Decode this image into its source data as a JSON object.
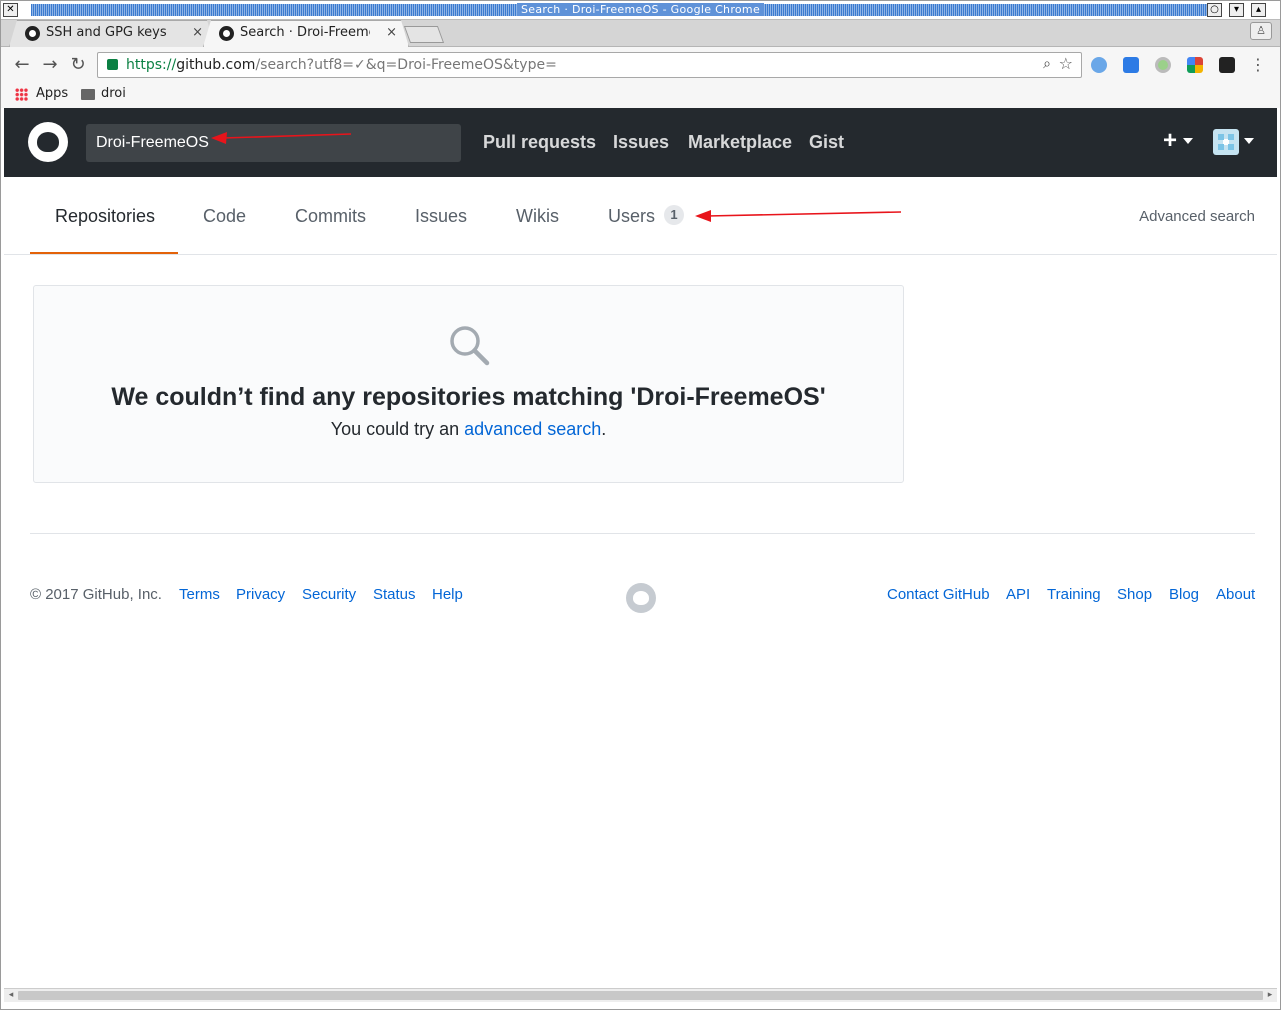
{
  "window": {
    "title": "Search · Droi-FreemeOS - Google Chrome"
  },
  "tabs": [
    {
      "label": "SSH and GPG keys",
      "close": "×"
    },
    {
      "label": "Search · Droi-Freeme",
      "close": "×"
    }
  ],
  "toolbar": {
    "url_scheme": "https://",
    "url_host": "github.com",
    "url_rest": "/search?utf8=✓&q=Droi-FreemeOS&type="
  },
  "bookmarks": {
    "apps": "Apps",
    "folder": "droi"
  },
  "header": {
    "search_value": "Droi-FreemeOS",
    "nav": [
      "Pull requests",
      "Issues",
      "Marketplace",
      "Gist"
    ],
    "plus": "+"
  },
  "subnav": {
    "items": [
      "Repositories",
      "Code",
      "Commits",
      "Issues",
      "Wikis",
      "Users"
    ],
    "users_count": "1",
    "advanced_search": "Advanced search"
  },
  "blankslate": {
    "heading": "We couldn’t find any repositories matching 'Droi-FreemeOS'",
    "text_before": "You could try an ",
    "link": "advanced search",
    "text_after": "."
  },
  "footer": {
    "copyright": "© 2017 GitHub, Inc.",
    "left_links": [
      "Terms",
      "Privacy",
      "Security",
      "Status",
      "Help"
    ],
    "right_links": [
      "Contact GitHub",
      "API",
      "Training",
      "Shop",
      "Blog",
      "About"
    ]
  },
  "colors": {
    "header_bg": "#24292e",
    "link": "#0366d6",
    "selected_underline": "#e36209",
    "annotation_arrow": "#e8141b"
  }
}
